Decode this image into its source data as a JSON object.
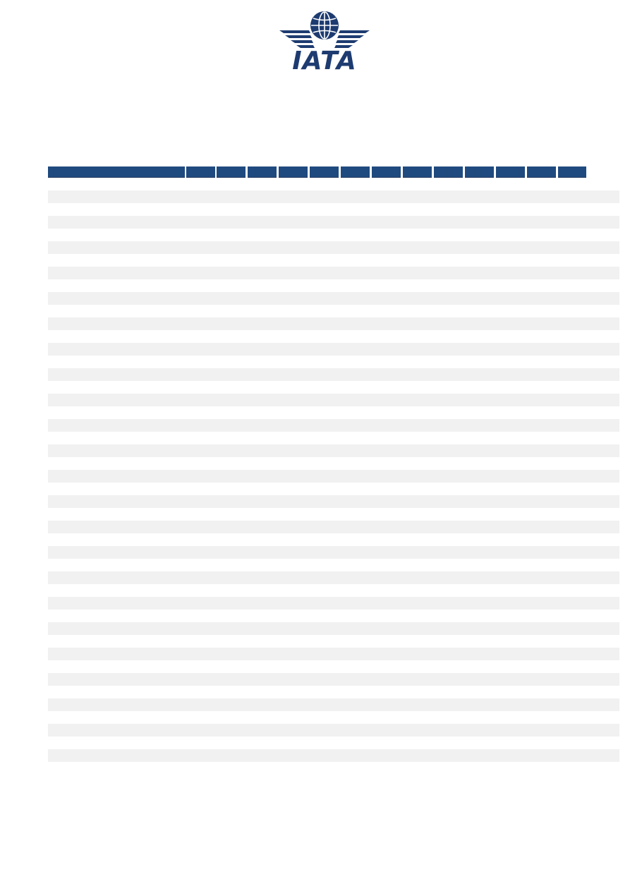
{
  "logo": {
    "wordmark": "IATA",
    "icon": "iata-globe-wings-logo"
  },
  "colors": {
    "brand_navy": "#1f4a7f",
    "logo_navy": "#1d3b70",
    "row_shade": "#f1f1f1"
  },
  "table": {
    "columns": [
      "",
      "",
      "",
      "",
      "",
      "",
      "",
      "",
      "",
      "",
      "",
      "",
      "",
      ""
    ],
    "rows": [
      {
        "cells": []
      },
      {
        "cells": []
      },
      {
        "cells": []
      },
      {
        "cells": []
      },
      {
        "cells": []
      },
      {
        "cells": []
      },
      {
        "cells": []
      },
      {
        "cells": []
      },
      {
        "cells": []
      },
      {
        "cells": []
      },
      {
        "cells": []
      },
      {
        "cells": []
      },
      {
        "cells": []
      },
      {
        "cells": []
      },
      {
        "cells": []
      },
      {
        "cells": []
      },
      {
        "cells": []
      },
      {
        "cells": []
      },
      {
        "cells": []
      },
      {
        "cells": []
      },
      {
        "cells": []
      },
      {
        "cells": []
      },
      {
        "cells": []
      }
    ]
  }
}
